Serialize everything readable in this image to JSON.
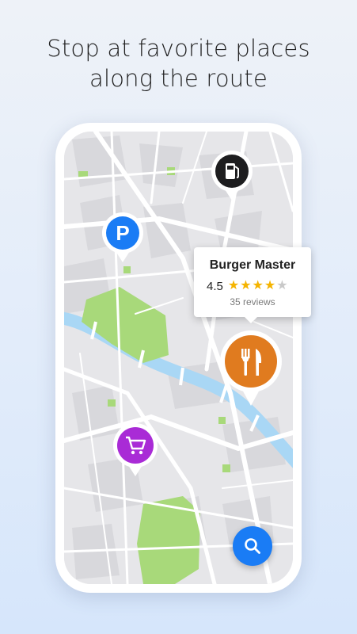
{
  "headline": {
    "line1": "Stop at favorite places",
    "line2": "along the route"
  },
  "place_card": {
    "name": "Burger Master",
    "rating_text": "4.5",
    "rating_value": 4.5,
    "stars_max": 5,
    "reviews": "35 reviews"
  },
  "pins": [
    {
      "name": "fuel-station-pin",
      "icon": "fuel-pump-icon",
      "color": "#1d1d1f"
    },
    {
      "name": "parking-pin",
      "icon": "parking-icon",
      "label": "P",
      "color": "#1a7cf5"
    },
    {
      "name": "restaurant-pin",
      "icon": "fork-knife-icon",
      "color": "#e07b1f"
    },
    {
      "name": "shopping-pin",
      "icon": "shopping-cart-icon",
      "color": "#a92bd6"
    }
  ],
  "search_button": {
    "icon": "search-icon",
    "color": "#1a7cf5"
  },
  "map": {
    "water_color": "#a9d7f5",
    "park_color": "#a8d97a",
    "block_color": "#dcdcdf",
    "road_color": "#ffffff"
  }
}
